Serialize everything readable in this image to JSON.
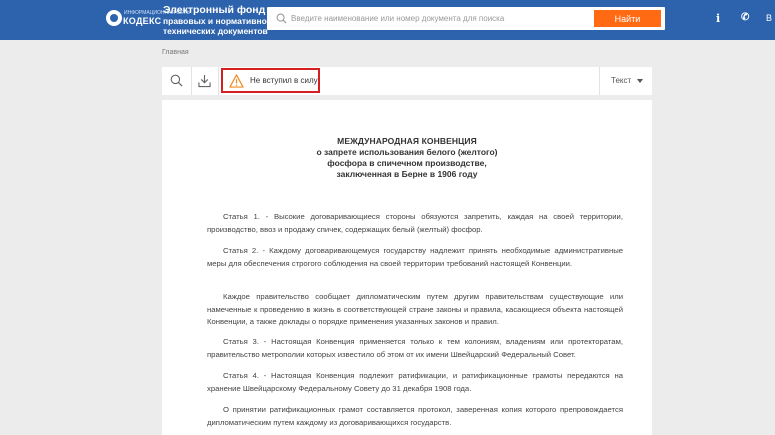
{
  "header": {
    "logo_small": "ИНФОРМАЦИОННАЯ СЕТЬ",
    "logo_main": "КОДЕКС",
    "fund_title_lines": [
      "Электронный фонд",
      "правовых и нормативно-",
      "технических документов"
    ],
    "search_placeholder": "Введите наименование или номер документа для поиска",
    "search_button": "Найти",
    "cut_label": "В"
  },
  "breadcrumb": "Главная",
  "toolbar": {
    "status": "Не вступил в силу",
    "view_label": "Текст"
  },
  "document": {
    "title": "МЕЖДУНАРОДНАЯ КОНВЕНЦИЯ",
    "subtitle_lines": [
      "о запрете использования белого (желтого)",
      "фосфора в спичечном производстве,",
      "заключенная в Берне в 1906 году"
    ],
    "paragraphs": [
      "Статья 1. - Высокие договаривающиеся стороны обязуются запретить, каждая на своей территории, производство, ввоз и продажу спичек, содержащих белый (желтый) фосфор.",
      "Статья 2. - Каждому договаривающемуся государству надлежит принять необходимые административные меры для обеспечения строгого соблюдения на своей территории требований настоящей Конвенции.",
      "Каждое правительство сообщает дипломатическим путем другим правительствам существующие или намеченные к проведению в жизнь в соответствующей стране законы и правила, касающиеся объекта настоящей Конвенции, а также доклады о порядке применения указанных законов и правил.",
      "Статья 3. - Настоящая Конвенция применяется только к тем колониям, владениям или протекторатам, правительство метрополии которых известило об этом от их имени Швейцарский Федеральный Совет.",
      "Статья 4. - Настоящая Конвенция подлежит ратификации, и ратификационные грамоты передаются на хранение Швейцарскому Федеральному Совету до 31 декабря 1908 года.",
      "О принятии ратификационных грамот составляется протокол, заверенная копия которого препровождается дипломатическим путем каждому из договаривающихся государств."
    ]
  }
}
